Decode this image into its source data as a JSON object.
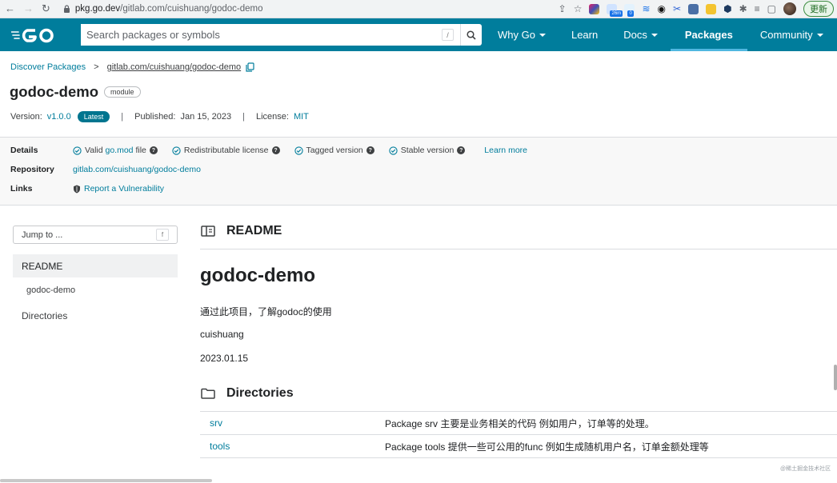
{
  "browser": {
    "url_host": "pkg.go.dev",
    "url_path": "/gitlab.com/cuishuang/godoc-demo",
    "ext_badge_1": "26m",
    "ext_badge_2": "0",
    "update_label": "更新"
  },
  "header": {
    "search_placeholder": "Search packages or symbols",
    "search_shortcut": "/",
    "nav": [
      {
        "label": "Why Go",
        "dropdown": true
      },
      {
        "label": "Learn",
        "dropdown": false
      },
      {
        "label": "Docs",
        "dropdown": true
      },
      {
        "label": "Packages",
        "dropdown": false,
        "active": true
      },
      {
        "label": "Community",
        "dropdown": true
      }
    ],
    "brand_color": "#007d9c"
  },
  "breadcrumb": {
    "root": "Discover Packages",
    "separator": ">",
    "current": "gitlab.com/cuishuang/godoc-demo"
  },
  "title": {
    "name": "godoc-demo",
    "chip": "module"
  },
  "meta": {
    "version_label": "Version:",
    "version": "v1.0.0",
    "latest": "Latest",
    "published_label": "Published:",
    "published": "Jan 15, 2023",
    "license_label": "License:",
    "license": "MIT"
  },
  "details": {
    "details_label": "Details",
    "checks": [
      {
        "pre": "Valid ",
        "link": "go.mod",
        "post": " file"
      },
      {
        "pre": "Redistributable license",
        "link": "",
        "post": ""
      },
      {
        "pre": "Tagged version",
        "link": "",
        "post": ""
      },
      {
        "pre": "Stable version",
        "link": "",
        "post": ""
      }
    ],
    "learn_more": "Learn more",
    "repository_label": "Repository",
    "repository": "gitlab.com/cuishuang/godoc-demo",
    "links_label": "Links",
    "report": "Report a Vulnerability"
  },
  "sidebar": {
    "jump_placeholder": "Jump to ...",
    "jump_key": "f",
    "readme": "README",
    "readme_sub": "godoc-demo",
    "directories": "Directories"
  },
  "main": {
    "readme_header": "README",
    "heading": "godoc-demo",
    "paragraphs": [
      "通过此项目，了解godoc的使用",
      "cuishuang",
      "2023.01.15"
    ],
    "directories_header": "Directories",
    "directories": [
      {
        "name": "srv",
        "desc": "Package srv 主要是业务相关的代码 例如用户，订单等的处理。"
      },
      {
        "name": "tools",
        "desc": "Package tools 提供一些可公用的func 例如生成随机用户名，订单金额处理等"
      }
    ]
  },
  "watermark": "@稀土掘金技术社区"
}
